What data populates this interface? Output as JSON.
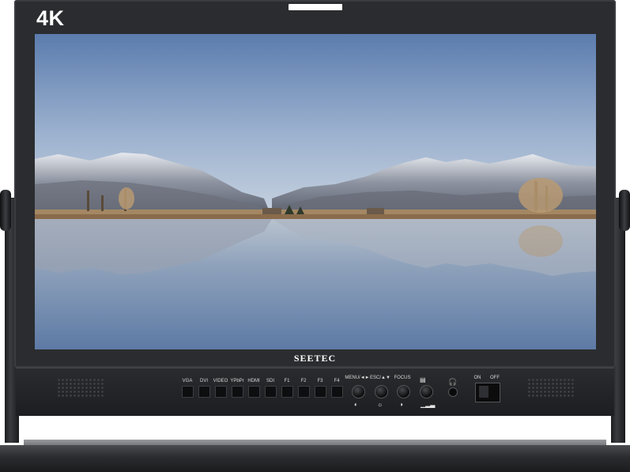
{
  "device": {
    "badge": "4K",
    "brand": "SEETEC"
  },
  "buttons": [
    {
      "label": "VGA"
    },
    {
      "label": "DVI"
    },
    {
      "label": "VIDEO"
    },
    {
      "label": "YPbPr"
    },
    {
      "label": "HDMI"
    },
    {
      "label": "SDI"
    },
    {
      "label": "F1"
    },
    {
      "label": "F2"
    },
    {
      "label": "F3"
    },
    {
      "label": "F4"
    }
  ],
  "knobs": [
    {
      "label": "MENU/◄►",
      "icon": "contrast-icon"
    },
    {
      "label": "ESC/▲▼",
      "icon": "brightness-icon"
    },
    {
      "label": "FOCUS",
      "icon": "saturation-icon"
    },
    {
      "label": "",
      "icon": "volume-icon"
    }
  ],
  "power": {
    "on_label": "ON",
    "off_label": "OFF"
  },
  "colors": {
    "bezel": "#2b2c2f",
    "panel": "#1d1e21",
    "sky_top": "#5e7fb0",
    "water": "#7b92b1"
  }
}
